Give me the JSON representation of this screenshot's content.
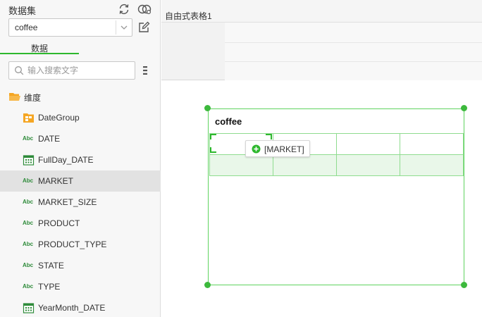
{
  "dataset_panel": {
    "title": "数据集",
    "selected_dataset": "coffee",
    "tab_label": "数据",
    "search_placeholder": "输入搜索文字"
  },
  "tree": {
    "root": {
      "label": "维度",
      "icon": "folder-open-icon"
    },
    "items": [
      {
        "label": "DateGroup",
        "icon": "group-folder-icon"
      },
      {
        "label": "DATE",
        "icon": "abc-icon"
      },
      {
        "label": "FullDay_DATE",
        "icon": "calendar-icon"
      },
      {
        "label": "MARKET",
        "icon": "abc-icon",
        "selected": true
      },
      {
        "label": "MARKET_SIZE",
        "icon": "abc-icon"
      },
      {
        "label": "PRODUCT",
        "icon": "abc-icon"
      },
      {
        "label": "PRODUCT_TYPE",
        "icon": "abc-icon"
      },
      {
        "label": "STATE",
        "icon": "abc-icon"
      },
      {
        "label": "TYPE",
        "icon": "abc-icon"
      },
      {
        "label": "YearMonth_DATE",
        "icon": "calendar-icon"
      }
    ]
  },
  "canvas": {
    "sheet_tab": "自由式表格1",
    "widget_title": "coffee",
    "drag_tooltip": "[MARKET]"
  },
  "colors": {
    "accent": "#2eb82e",
    "selection_border": "#5fd35f",
    "abc_text": "#2e8b3a",
    "folder": "#f5a623"
  }
}
